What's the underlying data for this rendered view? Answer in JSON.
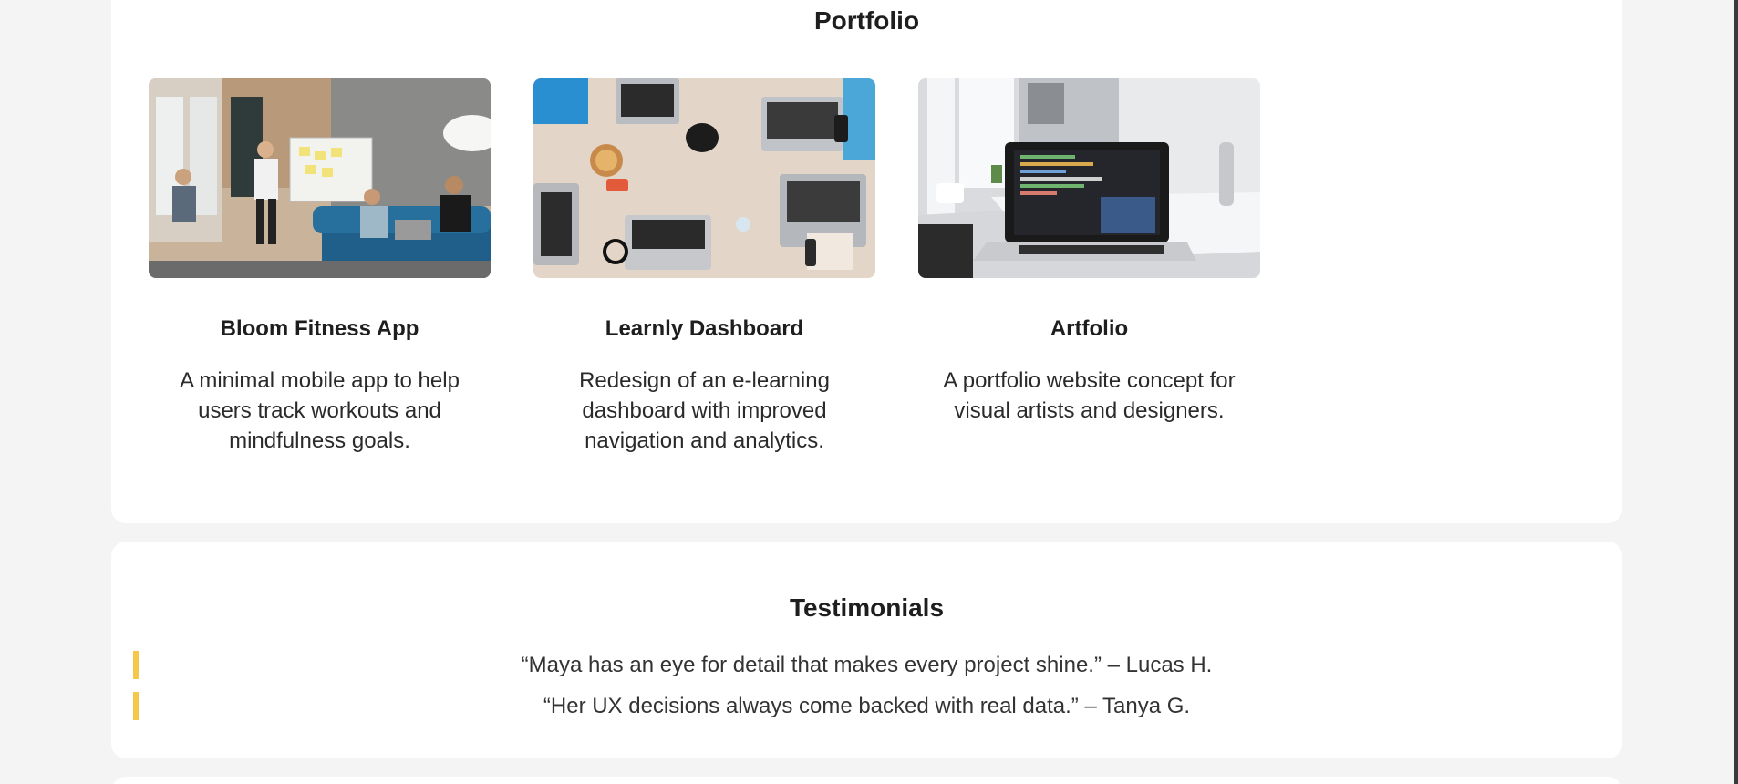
{
  "portfolio": {
    "title": "Portfolio",
    "projects": [
      {
        "title": "Bloom Fitness App",
        "description": "A minimal mobile app to help users track workouts and mindfulness goals.",
        "image": "team-meeting-office-photo"
      },
      {
        "title": "Learnly Dashboard",
        "description": "Redesign of an e-learning dashboard with improved navigation and analytics.",
        "image": "laptops-desk-overhead-photo"
      },
      {
        "title": "Artfolio",
        "description": "A portfolio website concept for visual artists and designers.",
        "image": "laptop-code-desk-photo"
      }
    ]
  },
  "testimonials": {
    "title": "Testimonials",
    "quotes": [
      "“Maya has an eye for detail that makes every project shine.” – Lucas H.",
      "“Her UX decisions always come backed with real data.” – Tanya G."
    ]
  },
  "colors": {
    "page_bg": "#f4f4f4",
    "card_bg": "#ffffff",
    "accent": "#f5c84b",
    "text": "#1e1e1e"
  }
}
